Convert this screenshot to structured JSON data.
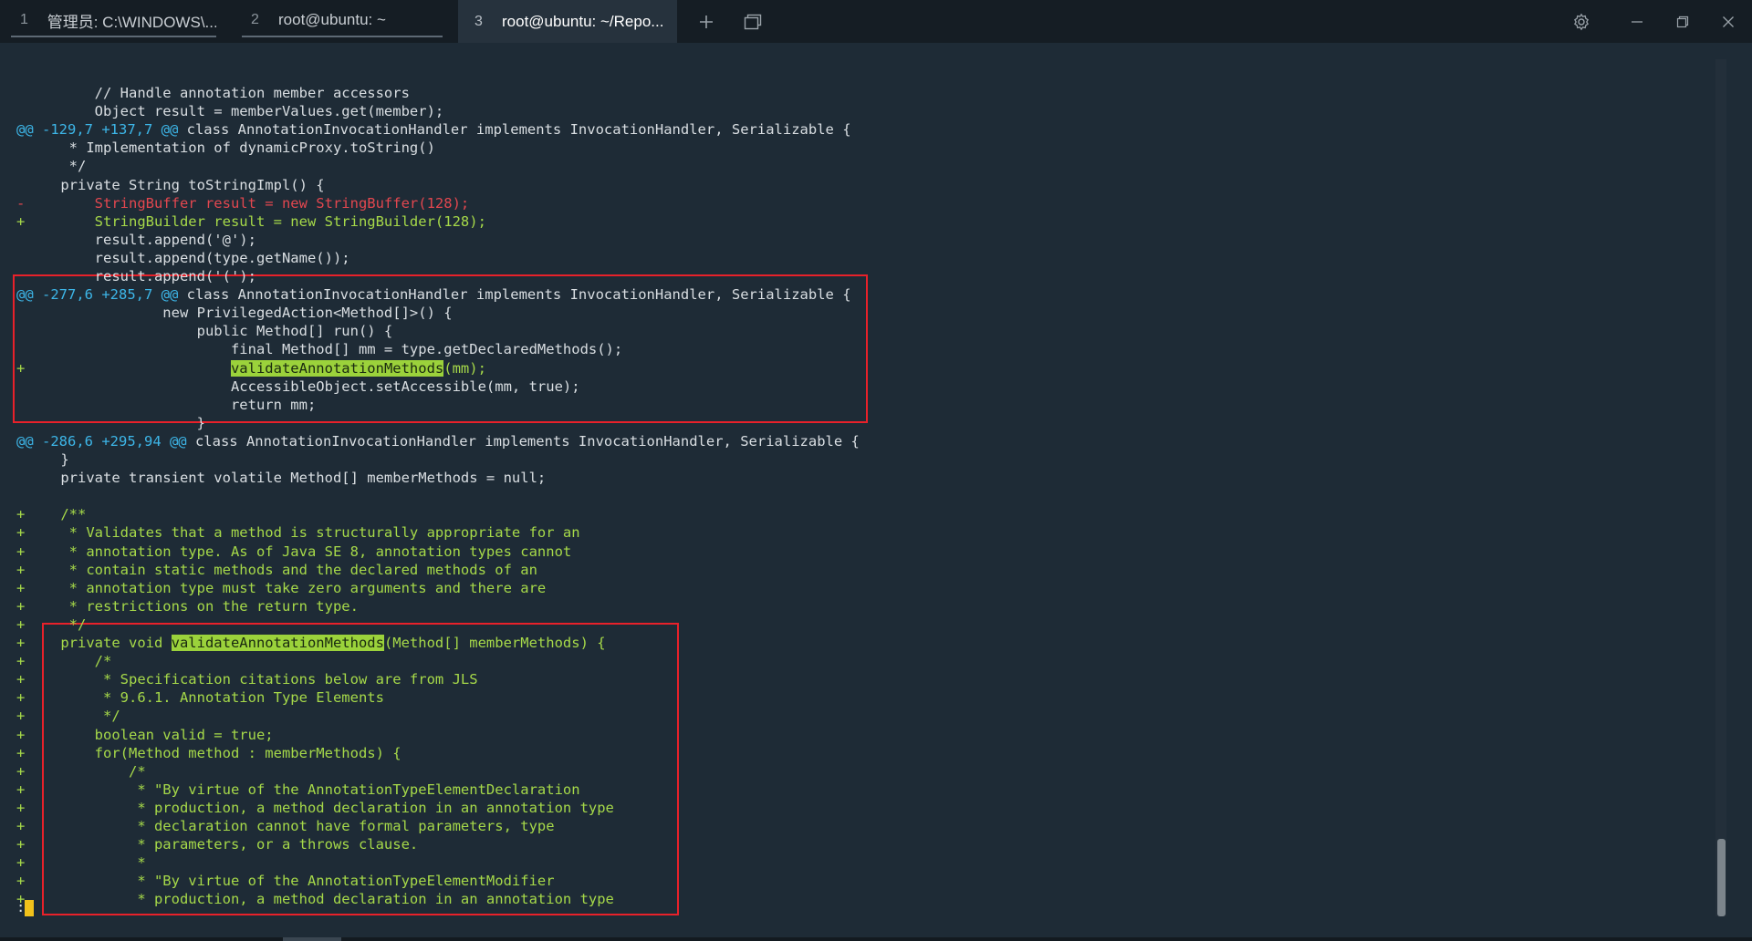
{
  "tabs": [
    {
      "number": "1",
      "title": "管理员: C:\\WINDOWS\\..."
    },
    {
      "number": "2",
      "title": "root@ubuntu: ~"
    },
    {
      "number": "3",
      "title": "root@ubuntu: ~/Repo..."
    }
  ],
  "icons": {
    "new_tab": "plus-icon",
    "split": "window-icon",
    "settings": "gear-icon",
    "minimize": "minimize-icon",
    "restore": "restore-icon",
    "close": "close-icon"
  },
  "colors": {
    "added": "#a6d949",
    "removed": "#e2474f",
    "hunk": "#3db6e8",
    "highlight": "#9bd23b",
    "box": "#e8212a",
    "cursor": "#f2c21b"
  },
  "lines": [
    {
      "type": "ctx",
      "marker": "",
      "text": "        // Handle annotation member accessors"
    },
    {
      "type": "ctx",
      "marker": "",
      "text": "        Object result = memberValues.get(member);"
    },
    {
      "type": "hunk",
      "marker": "@@",
      "hunk": "-129,7 +137,7 @@",
      "text": " class AnnotationInvocationHandler implements InvocationHandler, Serializable {"
    },
    {
      "type": "ctx",
      "marker": "",
      "text": "     * Implementation of dynamicProxy.toString()"
    },
    {
      "type": "ctx",
      "marker": "",
      "text": "     */"
    },
    {
      "type": "ctx",
      "marker": "",
      "text": "    private String toStringImpl() {"
    },
    {
      "type": "del",
      "marker": "-",
      "text": "        StringBuffer result = new StringBuffer(128);"
    },
    {
      "type": "add",
      "marker": "+",
      "text": "        StringBuilder result = new StringBuilder(128);"
    },
    {
      "type": "ctx",
      "marker": "",
      "text": "        result.append('@');"
    },
    {
      "type": "ctx",
      "marker": "",
      "text": "        result.append(type.getName());"
    },
    {
      "type": "ctx",
      "marker": "",
      "text": "        result.append('(');"
    },
    {
      "type": "hunk",
      "marker": "@@",
      "hunk": "-277,6 +285,7 @@",
      "text": " class AnnotationInvocationHandler implements InvocationHandler, Serializable {"
    },
    {
      "type": "ctx",
      "marker": "",
      "text": "                new PrivilegedAction<Method[]>() {"
    },
    {
      "type": "ctx",
      "marker": "",
      "text": "                    public Method[] run() {"
    },
    {
      "type": "ctx",
      "marker": "",
      "text": "                        final Method[] mm = type.getDeclaredMethods();"
    },
    {
      "type": "add",
      "marker": "+",
      "pre": "                        ",
      "hl": "validateAnnotationMethods",
      "post": "(mm);"
    },
    {
      "type": "ctx",
      "marker": "",
      "text": "                        AccessibleObject.setAccessible(mm, true);"
    },
    {
      "type": "ctx",
      "marker": "",
      "text": "                        return mm;"
    },
    {
      "type": "ctx",
      "marker": "",
      "text": "                    }"
    },
    {
      "type": "hunk",
      "marker": "@@",
      "hunk": "-286,6 +295,94 @@",
      "text": " class AnnotationInvocationHandler implements InvocationHandler, Serializable {"
    },
    {
      "type": "ctx",
      "marker": "",
      "text": "    }"
    },
    {
      "type": "ctx",
      "marker": "",
      "text": "    private transient volatile Method[] memberMethods = null;"
    },
    {
      "type": "ctx",
      "marker": "",
      "text": ""
    },
    {
      "type": "add",
      "marker": "+",
      "text": "    /**"
    },
    {
      "type": "add",
      "marker": "+",
      "text": "     * Validates that a method is structurally appropriate for an"
    },
    {
      "type": "add",
      "marker": "+",
      "text": "     * annotation type. As of Java SE 8, annotation types cannot"
    },
    {
      "type": "add",
      "marker": "+",
      "text": "     * contain static methods and the declared methods of an"
    },
    {
      "type": "add",
      "marker": "+",
      "text": "     * annotation type must take zero arguments and there are"
    },
    {
      "type": "add",
      "marker": "+",
      "text": "     * restrictions on the return type."
    },
    {
      "type": "add",
      "marker": "+",
      "text": "     */"
    },
    {
      "type": "add",
      "marker": "+",
      "pre": "    private void ",
      "hl": "validateAnnotationMethods",
      "post": "(Method[] memberMethods) {"
    },
    {
      "type": "add",
      "marker": "+",
      "text": "        /*"
    },
    {
      "type": "add",
      "marker": "+",
      "text": "         * Specification citations below are from JLS"
    },
    {
      "type": "add",
      "marker": "+",
      "text": "         * 9.6.1. Annotation Type Elements"
    },
    {
      "type": "add",
      "marker": "+",
      "text": "         */"
    },
    {
      "type": "add",
      "marker": "+",
      "text": "        boolean valid = true;"
    },
    {
      "type": "add",
      "marker": "+",
      "text": "        for(Method method : memberMethods) {"
    },
    {
      "type": "add",
      "marker": "+",
      "text": "            /*"
    },
    {
      "type": "add",
      "marker": "+",
      "text": "             * \"By virtue of the AnnotationTypeElementDeclaration"
    },
    {
      "type": "add",
      "marker": "+",
      "text": "             * production, a method declaration in an annotation type"
    },
    {
      "type": "add",
      "marker": "+",
      "text": "             * declaration cannot have formal parameters, type"
    },
    {
      "type": "add",
      "marker": "+",
      "text": "             * parameters, or a throws clause."
    },
    {
      "type": "add",
      "marker": "+",
      "text": "             *"
    },
    {
      "type": "add",
      "marker": "+",
      "text": "             * \"By virtue of the AnnotationTypeElementModifier"
    },
    {
      "type": "add",
      "marker": "+",
      "text": "             * production, a method declaration in an annotation type"
    }
  ],
  "prompt": ":"
}
